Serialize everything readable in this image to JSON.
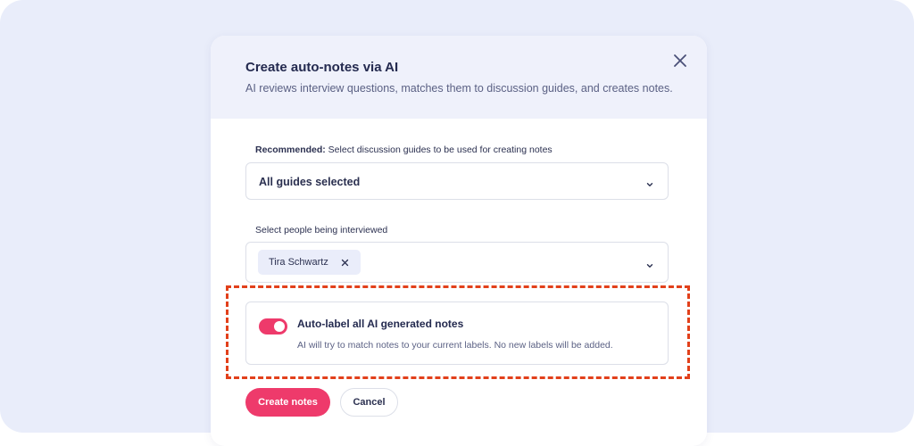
{
  "modal": {
    "title": "Create auto-notes via AI",
    "subtitle": "AI reviews interview questions, matches them to discussion guides, and creates notes.",
    "close_icon": "close-icon"
  },
  "guides": {
    "label_prefix": "Recommended:",
    "label_rest": " Select discussion guides to be used for creating notes",
    "value": "All guides selected"
  },
  "people": {
    "label": "Select people being interviewed",
    "chips": [
      {
        "name": "Tira Schwartz"
      }
    ]
  },
  "auto_label": {
    "enabled": true,
    "title": "Auto-label all AI generated notes",
    "description": "AI will try to match notes to your current labels. No new labels will be added."
  },
  "actions": {
    "create_label": "Create notes",
    "cancel_label": "Cancel"
  },
  "colors": {
    "accent": "#ee3a6b",
    "highlight": "#e2401b",
    "backdrop": "#e9edfa",
    "header_bg": "#eff1fb"
  }
}
